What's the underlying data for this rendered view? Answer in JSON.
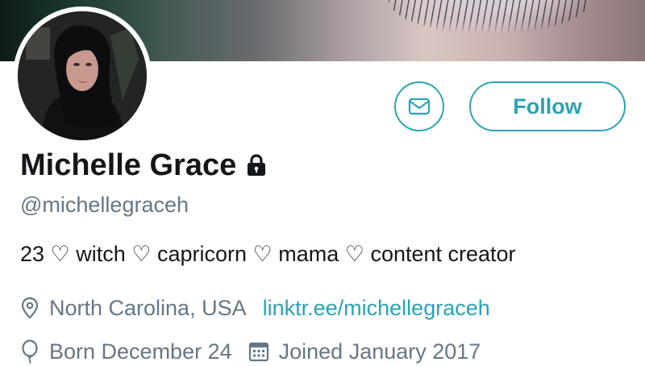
{
  "profile": {
    "display_name": "Michelle Grace",
    "handle": "@michellegraceh",
    "bio": "23 ♡ witch ♡ capricorn ♡ mama ♡ content creator",
    "location": "North Carolina, USA",
    "website": "linktr.ee/michellegraceh",
    "birthday": "Born December 24",
    "joined": "Joined January 2017",
    "protected": true
  },
  "actions": {
    "follow_label": "Follow",
    "message_icon": "envelope-icon"
  },
  "icons": {
    "lock": "lock-icon",
    "location": "location-pin-icon",
    "birthday": "balloon-icon",
    "joined": "calendar-icon"
  },
  "colors": {
    "accent": "#2aa3b4",
    "text": "#14171a",
    "secondary_text": "#657786",
    "background": "#ffffff"
  }
}
